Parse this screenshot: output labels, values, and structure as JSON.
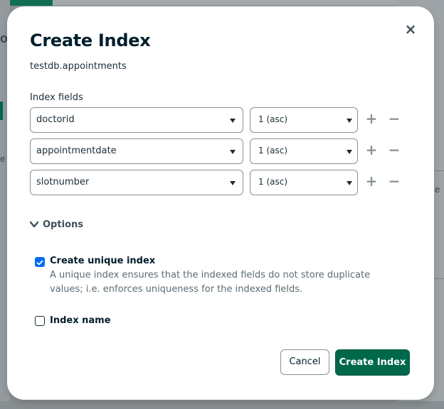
{
  "modal": {
    "title": "Create Index",
    "namespace": "testdb.appointments",
    "fields_label": "Index fields",
    "fields": [
      {
        "name": "doctorid",
        "direction": "1 (asc)"
      },
      {
        "name": "appointmentdate",
        "direction": "1 (asc)"
      },
      {
        "name": "slotnumber",
        "direction": "1 (asc)"
      }
    ],
    "add_symbol": "+",
    "remove_symbol": "−",
    "close_symbol": "×",
    "options_label": "Options",
    "options": [
      {
        "label": "Create unique index",
        "checked": true,
        "description": "A unique index ensures that the indexed fields do not store duplicate values; i.e. enforces uniqueness for the indexed fields."
      },
      {
        "label": "Index name",
        "checked": false,
        "description": ""
      }
    ],
    "cancel_label": "Cancel",
    "create_label": "Create Index"
  },
  "background": {
    "fragments": [
      "o",
      "e",
      "e"
    ]
  },
  "colors": {
    "primary": "#00684a",
    "checkbox": "#016bf8",
    "text": "#001e2b",
    "muted": "#5c6c75",
    "border": "#889397"
  }
}
